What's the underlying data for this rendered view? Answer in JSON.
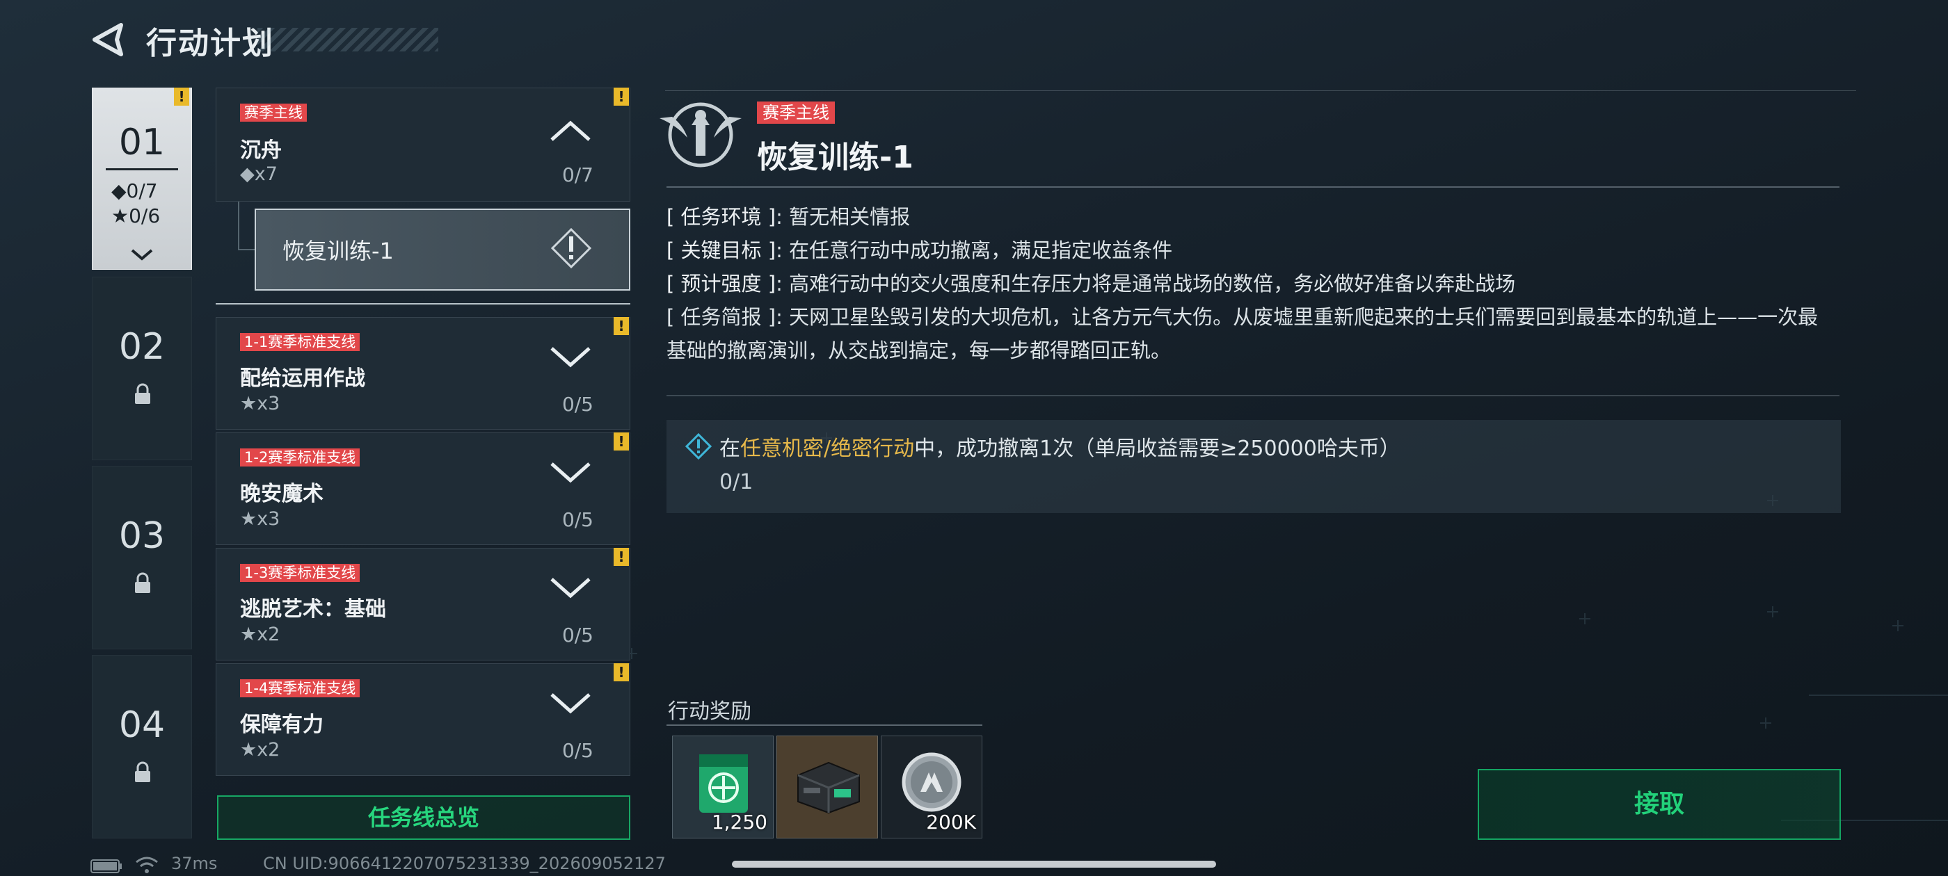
{
  "header": {
    "title": "行动计划"
  },
  "chapters": [
    {
      "number": "01",
      "diamond_progress": "◆0/7",
      "star_progress": "★0/6",
      "selected": true
    },
    {
      "number": "02",
      "locked": true
    },
    {
      "number": "03",
      "locked": true
    },
    {
      "number": "04",
      "locked": true
    }
  ],
  "quests": [
    {
      "tag": "赛季主线",
      "name": "沉舟",
      "count": "◆x7",
      "progress": "0/7",
      "expanded": true
    },
    {
      "tag": "1-1赛季标准支线",
      "name": "配给运用作战",
      "count": "★x3",
      "progress": "0/5"
    },
    {
      "tag": "1-2赛季标准支线",
      "name": "晚安魔术",
      "count": "★x3",
      "progress": "0/5"
    },
    {
      "tag": "1-3赛季标准支线",
      "name": "逃脱艺术：基础",
      "count": "★x2",
      "progress": "0/5"
    },
    {
      "tag": "1-4赛季标准支线",
      "name": "保障有力",
      "count": "★x2",
      "progress": "0/5"
    }
  ],
  "sub_quest": {
    "label": "恢复训练-1"
  },
  "overview_button": "任务线总览",
  "detail": {
    "tag": "赛季主线",
    "title": "恢复训练-1",
    "environment": {
      "key": "[ 任务环境 ]",
      "value": ": 暂无相关情报"
    },
    "goal": {
      "key": "[ 关键目标 ]",
      "value": ": 在任意行动中成功撤离，满足指定收益条件"
    },
    "intensity": {
      "key": "[ 预计强度 ]",
      "value": ": 高难行动中的交火强度和生存压力将是通常战场的数倍，务必做好准备以奔赴战场"
    },
    "brief": {
      "key": "[ 任务简报 ]",
      "value": ": 天网卫星坠毁引发的大坝危机，让各方元气大伤。从废墟里重新爬起来的士兵们需要回到最基本的轨道上——一次最基础的撤离演训，从交战到搞定，每一步都得踏回正轨。"
    },
    "objective": {
      "prefix": "在",
      "highlight": "任意机密/绝密行动",
      "suffix": "中，成功撤离1次（单局收益需要≥250000哈夫币）",
      "progress": "0/1"
    }
  },
  "rewards": {
    "label": "行动奖励",
    "items": [
      {
        "icon": "exp-card-icon",
        "count": "1,250"
      },
      {
        "icon": "equipment-case-icon",
        "count": ""
      },
      {
        "icon": "haf-coin-icon",
        "count": "200K"
      }
    ]
  },
  "claim_button": "接取",
  "status": {
    "ping": "37ms",
    "uid": "CN UID:9066412207075231339_202609052127"
  },
  "colors": {
    "tag_red": "#e2474a",
    "accent_green": "#22d17a",
    "alert_yellow": "#e9b92a",
    "highlight_gold": "#e6b84a"
  }
}
